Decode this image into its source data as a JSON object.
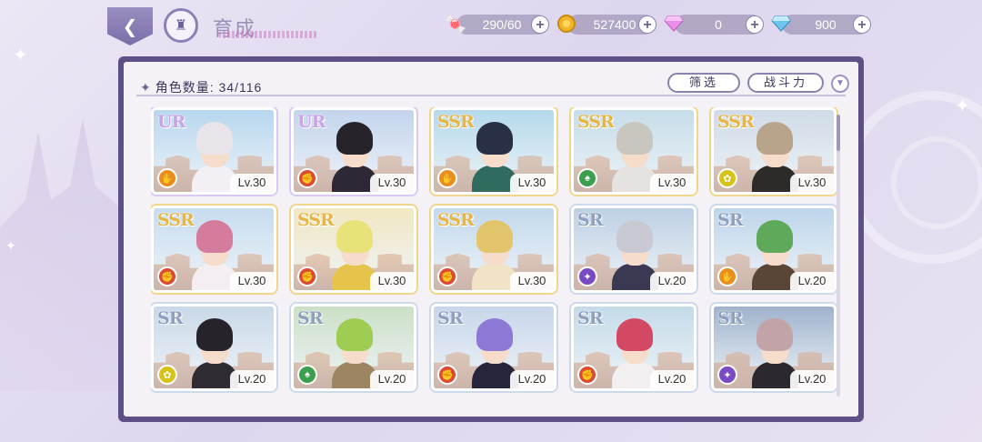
{
  "header": {
    "title": "育成"
  },
  "resources": [
    {
      "icon": "candy-icon",
      "value": "290/60",
      "color": "#e25d7c"
    },
    {
      "icon": "gold-coin-icon",
      "value": "527400",
      "color": "#e7a81f"
    },
    {
      "icon": "pink-diamond-icon",
      "value": "0",
      "color": "#e07bd8"
    },
    {
      "icon": "blue-diamond-icon",
      "value": "900",
      "color": "#5cb8e8"
    }
  ],
  "panel": {
    "count_label": "角色数量:",
    "count_value": "34/116",
    "filter_label": "筛选",
    "sort_label": "战斗力"
  },
  "cards": [
    {
      "rarity": "UR",
      "element": "orange",
      "level": "Lv.30",
      "hair": "#e8e4ea",
      "outfit": "#f2f0f4",
      "sky": "#b7d6ee"
    },
    {
      "rarity": "UR",
      "element": "red",
      "level": "Lv.30",
      "hair": "#26232b",
      "outfit": "#2d2833",
      "sky": "#c3d4ec"
    },
    {
      "rarity": "SSR",
      "element": "orange",
      "level": "Lv.30",
      "hair": "#283045",
      "outfit": "#2f6b5e",
      "sky": "#b5d9ea"
    },
    {
      "rarity": "SSR",
      "element": "green",
      "level": "Lv.30",
      "hair": "#c9c6c0",
      "outfit": "#e5e3df",
      "sky": "#c6dde9"
    },
    {
      "rarity": "SSR",
      "element": "yellow",
      "level": "Lv.30",
      "hair": "#b8a48a",
      "outfit": "#2d2a2a",
      "sky": "#cfdbe6"
    },
    {
      "rarity": "SSR",
      "element": "red",
      "level": "Lv.30",
      "hair": "#d47b9e",
      "outfit": "#f4eef2",
      "sky": "#c6dcef"
    },
    {
      "rarity": "SSR",
      "element": "red",
      "level": "Lv.30",
      "hair": "#e8e27a",
      "outfit": "#e6c44c",
      "sky": "#f1e7c2"
    },
    {
      "rarity": "SSR",
      "element": "red",
      "level": "Lv.30",
      "hair": "#e2c46a",
      "outfit": "#f1e3c6",
      "sky": "#c2d9ec"
    },
    {
      "rarity": "SR",
      "element": "purple",
      "level": "Lv.20",
      "hair": "#c9c9d4",
      "outfit": "#3b3853",
      "sky": "#bdd0e3"
    },
    {
      "rarity": "SR",
      "element": "orange",
      "level": "Lv.20",
      "hair": "#5fa95a",
      "outfit": "#5a4637",
      "sky": "#bdd5ea"
    },
    {
      "rarity": "SR",
      "element": "yellow",
      "level": "Lv.20",
      "hair": "#26232b",
      "outfit": "#302c34",
      "sky": "#c9d9e8"
    },
    {
      "rarity": "SR",
      "element": "green",
      "level": "Lv.20",
      "hair": "#9fcc52",
      "outfit": "#9c8560",
      "sky": "#cbe0c6"
    },
    {
      "rarity": "SR",
      "element": "red",
      "level": "Lv.20",
      "hair": "#8e7ad6",
      "outfit": "#27253b",
      "sky": "#c8d6ea"
    },
    {
      "rarity": "SR",
      "element": "red",
      "level": "Lv.20",
      "hair": "#d34864",
      "outfit": "#f1efef",
      "sky": "#c4dbe8"
    },
    {
      "rarity": "SR",
      "element": "purple",
      "level": "Lv.20",
      "hair": "#c1a3a8",
      "outfit": "#2c2830",
      "sky": "#9fb3cc"
    }
  ]
}
